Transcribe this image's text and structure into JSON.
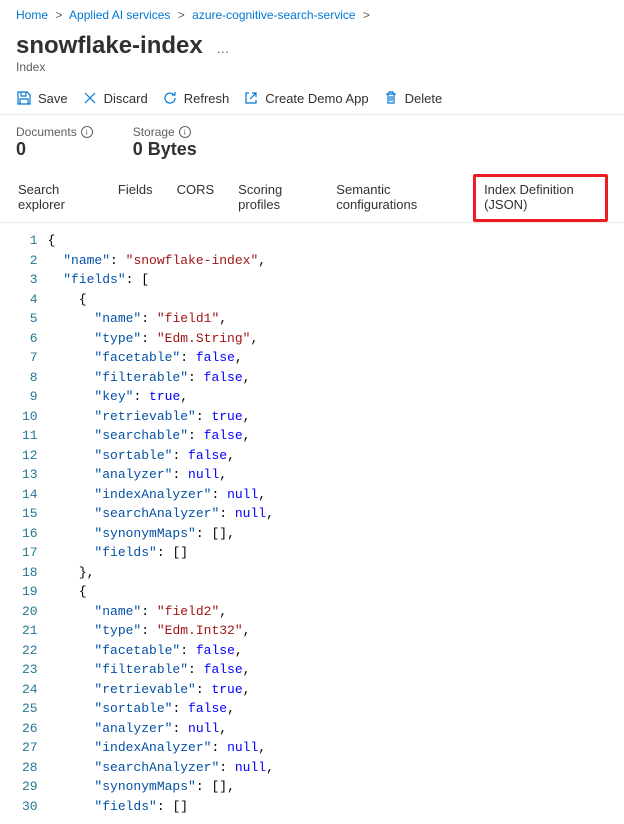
{
  "breadcrumb": {
    "items": [
      "Home",
      "Applied AI services",
      "azure-cognitive-search-service"
    ]
  },
  "title": "snowflake-index",
  "subtitle": "Index",
  "toolbar": {
    "save": "Save",
    "discard": "Discard",
    "refresh": "Refresh",
    "createDemo": "Create Demo App",
    "delete": "Delete"
  },
  "stats": {
    "documentsLabel": "Documents",
    "documentsValue": "0",
    "storageLabel": "Storage",
    "storageValue": "0 Bytes"
  },
  "tabs": {
    "searchExplorer": "Search explorer",
    "fields": "Fields",
    "cors": "CORS",
    "scoring": "Scoring profiles",
    "semantic": "Semantic configurations",
    "json": "Index Definition (JSON)"
  },
  "code": {
    "lines": [
      [
        [
          "brace",
          "{"
        ]
      ],
      [
        [
          "punc",
          "  "
        ],
        [
          "key",
          "\"name\""
        ],
        [
          "punc",
          ": "
        ],
        [
          "str",
          "\"snowflake-index\""
        ],
        [
          "punc",
          ","
        ]
      ],
      [
        [
          "punc",
          "  "
        ],
        [
          "key",
          "\"fields\""
        ],
        [
          "punc",
          ": ["
        ]
      ],
      [
        [
          "punc",
          "    "
        ],
        [
          "brace",
          "{"
        ]
      ],
      [
        [
          "punc",
          "      "
        ],
        [
          "key",
          "\"name\""
        ],
        [
          "punc",
          ": "
        ],
        [
          "str",
          "\"field1\""
        ],
        [
          "punc",
          ","
        ]
      ],
      [
        [
          "punc",
          "      "
        ],
        [
          "key",
          "\"type\""
        ],
        [
          "punc",
          ": "
        ],
        [
          "str",
          "\"Edm.String\""
        ],
        [
          "punc",
          ","
        ]
      ],
      [
        [
          "punc",
          "      "
        ],
        [
          "key",
          "\"facetable\""
        ],
        [
          "punc",
          ": "
        ],
        [
          "bool",
          "false"
        ],
        [
          "punc",
          ","
        ]
      ],
      [
        [
          "punc",
          "      "
        ],
        [
          "key",
          "\"filterable\""
        ],
        [
          "punc",
          ": "
        ],
        [
          "bool",
          "false"
        ],
        [
          "punc",
          ","
        ]
      ],
      [
        [
          "punc",
          "      "
        ],
        [
          "key",
          "\"key\""
        ],
        [
          "punc",
          ": "
        ],
        [
          "bool",
          "true"
        ],
        [
          "punc",
          ","
        ]
      ],
      [
        [
          "punc",
          "      "
        ],
        [
          "key",
          "\"retrievable\""
        ],
        [
          "punc",
          ": "
        ],
        [
          "bool",
          "true"
        ],
        [
          "punc",
          ","
        ]
      ],
      [
        [
          "punc",
          "      "
        ],
        [
          "key",
          "\"searchable\""
        ],
        [
          "punc",
          ": "
        ],
        [
          "bool",
          "false"
        ],
        [
          "punc",
          ","
        ]
      ],
      [
        [
          "punc",
          "      "
        ],
        [
          "key",
          "\"sortable\""
        ],
        [
          "punc",
          ": "
        ],
        [
          "bool",
          "false"
        ],
        [
          "punc",
          ","
        ]
      ],
      [
        [
          "punc",
          "      "
        ],
        [
          "key",
          "\"analyzer\""
        ],
        [
          "punc",
          ": "
        ],
        [
          "bool",
          "null"
        ],
        [
          "punc",
          ","
        ]
      ],
      [
        [
          "punc",
          "      "
        ],
        [
          "key",
          "\"indexAnalyzer\""
        ],
        [
          "punc",
          ": "
        ],
        [
          "bool",
          "null"
        ],
        [
          "punc",
          ","
        ]
      ],
      [
        [
          "punc",
          "      "
        ],
        [
          "key",
          "\"searchAnalyzer\""
        ],
        [
          "punc",
          ": "
        ],
        [
          "bool",
          "null"
        ],
        [
          "punc",
          ","
        ]
      ],
      [
        [
          "punc",
          "      "
        ],
        [
          "key",
          "\"synonymMaps\""
        ],
        [
          "punc",
          ": []"
        ],
        [
          "punc",
          ","
        ]
      ],
      [
        [
          "punc",
          "      "
        ],
        [
          "key",
          "\"fields\""
        ],
        [
          "punc",
          ": []"
        ]
      ],
      [
        [
          "punc",
          "    "
        ],
        [
          "brace",
          "},"
        ]
      ],
      [
        [
          "punc",
          "    "
        ],
        [
          "brace",
          "{"
        ]
      ],
      [
        [
          "punc",
          "      "
        ],
        [
          "key",
          "\"name\""
        ],
        [
          "punc",
          ": "
        ],
        [
          "str",
          "\"field2\""
        ],
        [
          "punc",
          ","
        ]
      ],
      [
        [
          "punc",
          "      "
        ],
        [
          "key",
          "\"type\""
        ],
        [
          "punc",
          ": "
        ],
        [
          "str",
          "\"Edm.Int32\""
        ],
        [
          "punc",
          ","
        ]
      ],
      [
        [
          "punc",
          "      "
        ],
        [
          "key",
          "\"facetable\""
        ],
        [
          "punc",
          ": "
        ],
        [
          "bool",
          "false"
        ],
        [
          "punc",
          ","
        ]
      ],
      [
        [
          "punc",
          "      "
        ],
        [
          "key",
          "\"filterable\""
        ],
        [
          "punc",
          ": "
        ],
        [
          "bool",
          "false"
        ],
        [
          "punc",
          ","
        ]
      ],
      [
        [
          "punc",
          "      "
        ],
        [
          "key",
          "\"retrievable\""
        ],
        [
          "punc",
          ": "
        ],
        [
          "bool",
          "true"
        ],
        [
          "punc",
          ","
        ]
      ],
      [
        [
          "punc",
          "      "
        ],
        [
          "key",
          "\"sortable\""
        ],
        [
          "punc",
          ": "
        ],
        [
          "bool",
          "false"
        ],
        [
          "punc",
          ","
        ]
      ],
      [
        [
          "punc",
          "      "
        ],
        [
          "key",
          "\"analyzer\""
        ],
        [
          "punc",
          ": "
        ],
        [
          "bool",
          "null"
        ],
        [
          "punc",
          ","
        ]
      ],
      [
        [
          "punc",
          "      "
        ],
        [
          "key",
          "\"indexAnalyzer\""
        ],
        [
          "punc",
          ": "
        ],
        [
          "bool",
          "null"
        ],
        [
          "punc",
          ","
        ]
      ],
      [
        [
          "punc",
          "      "
        ],
        [
          "key",
          "\"searchAnalyzer\""
        ],
        [
          "punc",
          ": "
        ],
        [
          "bool",
          "null"
        ],
        [
          "punc",
          ","
        ]
      ],
      [
        [
          "punc",
          "      "
        ],
        [
          "key",
          "\"synonymMaps\""
        ],
        [
          "punc",
          ": []"
        ],
        [
          "punc",
          ","
        ]
      ],
      [
        [
          "punc",
          "      "
        ],
        [
          "key",
          "\"fields\""
        ],
        [
          "punc",
          ": []"
        ]
      ]
    ]
  }
}
